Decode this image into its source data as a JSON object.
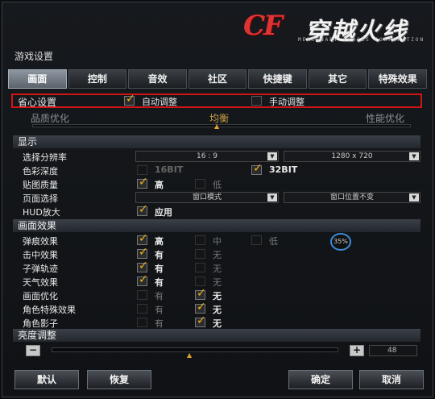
{
  "logo": {
    "brand": "CF",
    "title": "穿越火线",
    "subtitle": "MERCENARY FORCES CORPORATION"
  },
  "window_title": "游戏设置",
  "tabs": [
    "画面",
    "控制",
    "音效",
    "社区",
    "快捷键",
    "其它",
    "特殊效果"
  ],
  "power": {
    "label": "省心设置",
    "auto_label": "自动调整",
    "manual_label": "手动调整",
    "left": "品质优化",
    "mid": "均衡",
    "right": "性能优化"
  },
  "display": {
    "header": "显示",
    "resolution_label": "选择分辨率",
    "aspect": "16 : 9",
    "resolution": "1280 x 720",
    "color_depth_label": "色彩深度",
    "depth_16": "16BIT",
    "depth_32": "32BIT",
    "texture_label": "贴图质量",
    "high": "高",
    "low": "低",
    "page_label": "页面选择",
    "window_mode": "窗口模式",
    "window_pos": "窗口位置不变",
    "hud_label": "HUD放大",
    "apply": "应用"
  },
  "effects": {
    "header": "画面效果",
    "bullet_label": "弹痕效果",
    "high": "高",
    "mid": "中",
    "low": "低",
    "hit_label": "击中效果",
    "trail_label": "子弹轨迹",
    "weather_label": "天气效果",
    "optimize_label": "画面优化",
    "char_fx_label": "角色特殊效果",
    "shadow_label": "角色影子",
    "yes": "有",
    "no": "无",
    "progress": "35%"
  },
  "brightness": {
    "header": "亮度调整",
    "minus": "−",
    "plus": "+",
    "value": "48"
  },
  "buttons": {
    "default": "默认",
    "restore": "恢复",
    "ok": "确定",
    "cancel": "取消"
  }
}
